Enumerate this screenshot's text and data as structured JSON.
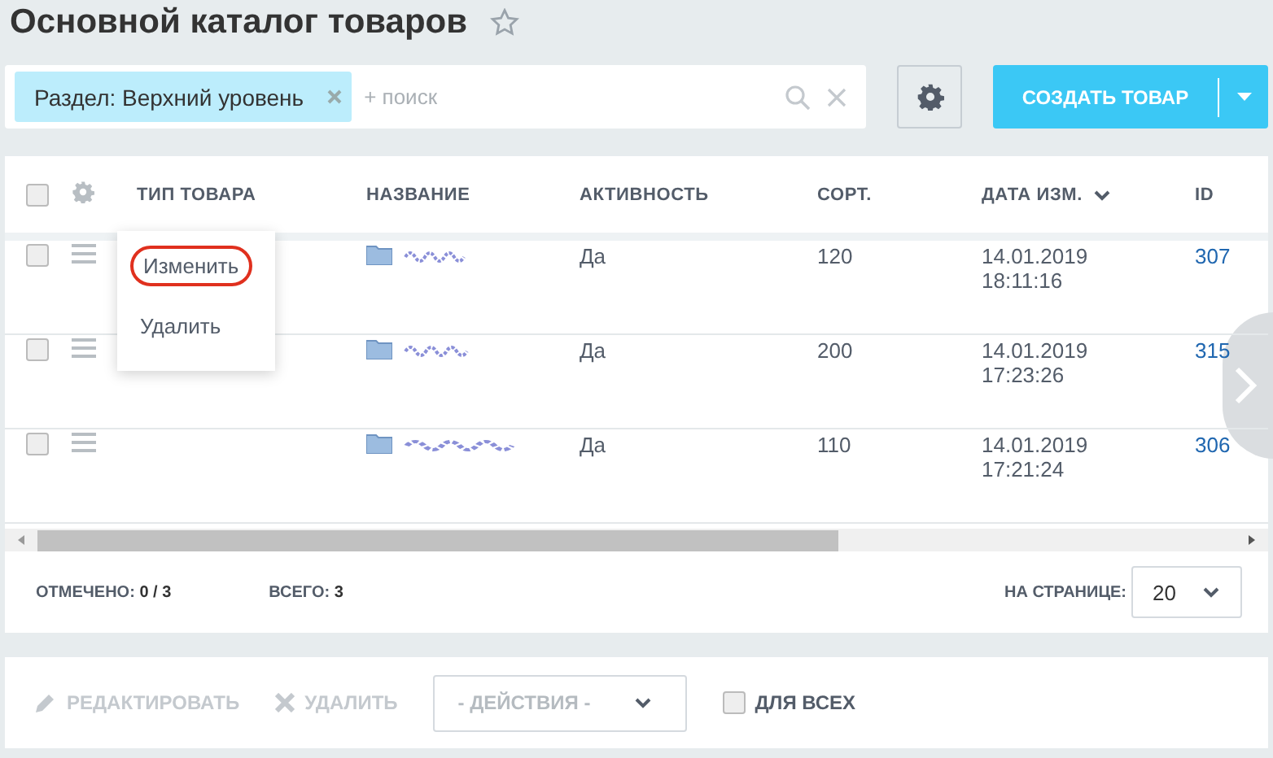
{
  "title": "Основной каталог товаров",
  "favorite": false,
  "filter": {
    "tag": "Раздел: Верхний уровень",
    "placeholder": "+ поиск"
  },
  "create_button": "СОЗДАТЬ ТОВАР",
  "select_all": {
    "checked": false
  },
  "columns": [
    {
      "label": "ТИП ТОВАРА",
      "sorted": false
    },
    {
      "label": "НАЗВАНИЕ",
      "sorted": false
    },
    {
      "label": "АКТИВНОСТЬ",
      "sorted": false
    },
    {
      "label": "СОРТ.",
      "sorted": false
    },
    {
      "label": "ДАТА ИЗМ.",
      "sorted": true
    },
    {
      "label": "ID",
      "sorted": false
    }
  ],
  "rows": [
    {
      "checked": false,
      "activity": "Да",
      "sort": "120",
      "date": "14.01.2019",
      "time": "18:11:16",
      "id": "307"
    },
    {
      "checked": false,
      "activity": "Да",
      "sort": "200",
      "date": "14.01.2019",
      "time": "17:23:26",
      "id": "315"
    },
    {
      "checked": false,
      "activity": "Да",
      "sort": "110",
      "date": "14.01.2019",
      "time": "17:21:24",
      "id": "306"
    }
  ],
  "context_menu": [
    {
      "label": "Изменить",
      "highlighted": true
    },
    {
      "label": "Удалить",
      "highlighted": false
    }
  ],
  "footer": {
    "checked_label": "ОТМЕЧЕНО:",
    "checked_value": "0 / 3",
    "total_label": "ВСЕГО:",
    "total_value": "3",
    "per_page_label": "НА СТРАНИЦЕ:",
    "per_page": "20"
  },
  "actions": {
    "edit": {
      "label": "РЕДАКТИРОВАТЬ",
      "disabled": true
    },
    "delete": {
      "label": "УДАЛИТЬ",
      "disabled": true
    },
    "select": "- ДЕЙСТВИЯ -",
    "for_all": {
      "label": "ДЛЯ ВСЕХ",
      "checked": false
    }
  }
}
